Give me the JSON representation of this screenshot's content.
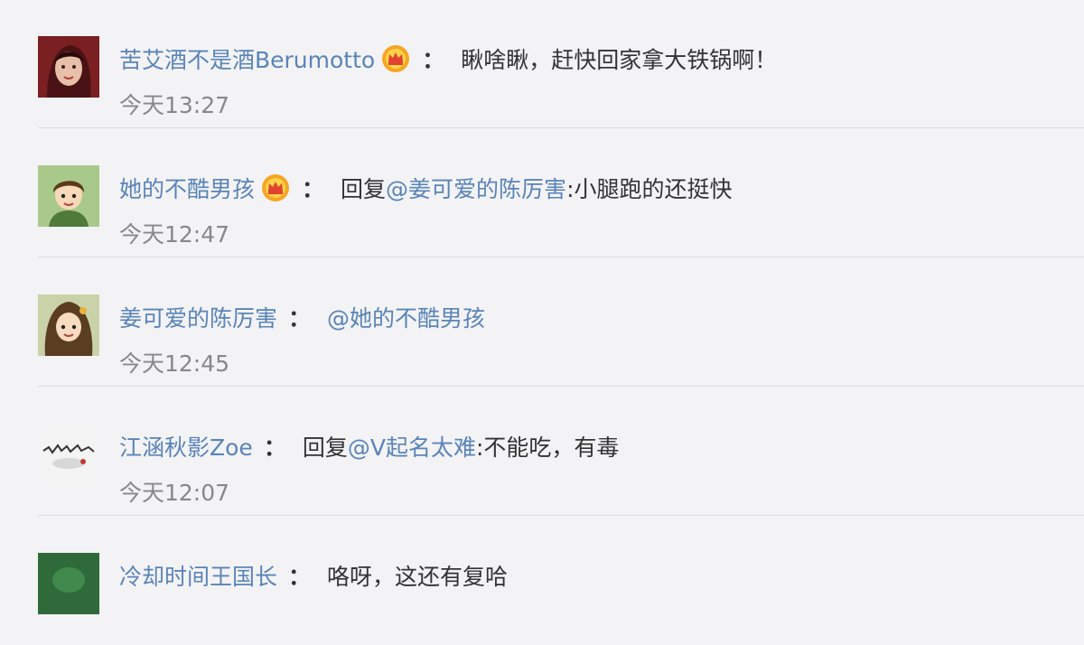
{
  "comments": [
    {
      "username": "苦艾酒不是酒Berumotto",
      "colon": "：",
      "text_before": "",
      "mention": "",
      "text_after": "瞅啥瞅，赶快回家拿大铁锅啊！",
      "time": "今天13:27"
    },
    {
      "username": "她的不酷男孩",
      "colon": "：",
      "text_before": "回复",
      "mention": "@姜可爱的陈厉害",
      "text_after": ":小腿跑的还挺快",
      "time": "今天12:47"
    },
    {
      "username": "姜可爱的陈厉害",
      "colon": "：",
      "text_before": "",
      "mention": "@她的不酷男孩",
      "text_after": "",
      "time": "今天12:45"
    },
    {
      "username": "江涵秋影Zoe",
      "colon": "：",
      "text_before": "回复",
      "mention": "@V起名太难",
      "text_after": ":不能吃，有毒",
      "time": "今天12:07"
    },
    {
      "username": "冷却时间王国长",
      "colon": "：",
      "text_before": "",
      "mention": "",
      "text_after": "咯呀，这还有复哈",
      "time": ""
    }
  ],
  "colors": {
    "username": "#5a84b8",
    "text": "#333333",
    "time": "#888888",
    "background": "#f3f3f5"
  },
  "icons": {
    "vip_badge": "crown-badge-icon"
  }
}
